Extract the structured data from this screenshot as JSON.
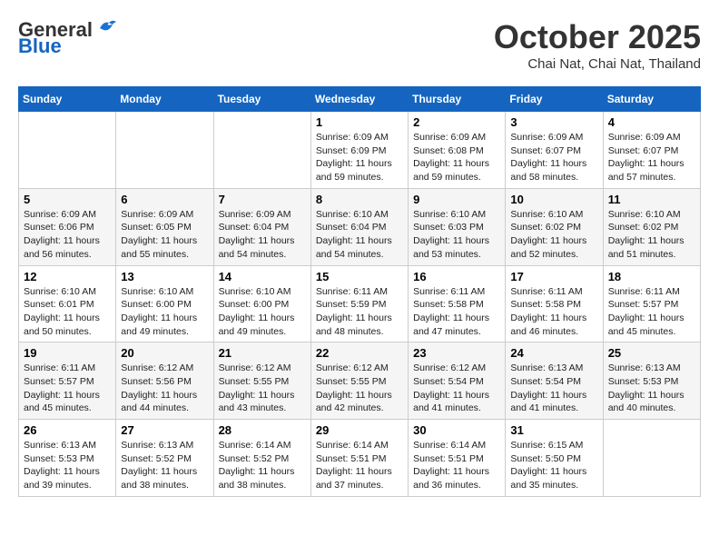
{
  "header": {
    "logo_general": "General",
    "logo_blue": "Blue",
    "month": "October 2025",
    "location": "Chai Nat, Chai Nat, Thailand"
  },
  "weekdays": [
    "Sunday",
    "Monday",
    "Tuesday",
    "Wednesday",
    "Thursday",
    "Friday",
    "Saturday"
  ],
  "weeks": [
    [
      {
        "day": "",
        "info": ""
      },
      {
        "day": "",
        "info": ""
      },
      {
        "day": "",
        "info": ""
      },
      {
        "day": "1",
        "info": "Sunrise: 6:09 AM\nSunset: 6:09 PM\nDaylight: 11 hours\nand 59 minutes."
      },
      {
        "day": "2",
        "info": "Sunrise: 6:09 AM\nSunset: 6:08 PM\nDaylight: 11 hours\nand 59 minutes."
      },
      {
        "day": "3",
        "info": "Sunrise: 6:09 AM\nSunset: 6:07 PM\nDaylight: 11 hours\nand 58 minutes."
      },
      {
        "day": "4",
        "info": "Sunrise: 6:09 AM\nSunset: 6:07 PM\nDaylight: 11 hours\nand 57 minutes."
      }
    ],
    [
      {
        "day": "5",
        "info": "Sunrise: 6:09 AM\nSunset: 6:06 PM\nDaylight: 11 hours\nand 56 minutes."
      },
      {
        "day": "6",
        "info": "Sunrise: 6:09 AM\nSunset: 6:05 PM\nDaylight: 11 hours\nand 55 minutes."
      },
      {
        "day": "7",
        "info": "Sunrise: 6:09 AM\nSunset: 6:04 PM\nDaylight: 11 hours\nand 54 minutes."
      },
      {
        "day": "8",
        "info": "Sunrise: 6:10 AM\nSunset: 6:04 PM\nDaylight: 11 hours\nand 54 minutes."
      },
      {
        "day": "9",
        "info": "Sunrise: 6:10 AM\nSunset: 6:03 PM\nDaylight: 11 hours\nand 53 minutes."
      },
      {
        "day": "10",
        "info": "Sunrise: 6:10 AM\nSunset: 6:02 PM\nDaylight: 11 hours\nand 52 minutes."
      },
      {
        "day": "11",
        "info": "Sunrise: 6:10 AM\nSunset: 6:02 PM\nDaylight: 11 hours\nand 51 minutes."
      }
    ],
    [
      {
        "day": "12",
        "info": "Sunrise: 6:10 AM\nSunset: 6:01 PM\nDaylight: 11 hours\nand 50 minutes."
      },
      {
        "day": "13",
        "info": "Sunrise: 6:10 AM\nSunset: 6:00 PM\nDaylight: 11 hours\nand 49 minutes."
      },
      {
        "day": "14",
        "info": "Sunrise: 6:10 AM\nSunset: 6:00 PM\nDaylight: 11 hours\nand 49 minutes."
      },
      {
        "day": "15",
        "info": "Sunrise: 6:11 AM\nSunset: 5:59 PM\nDaylight: 11 hours\nand 48 minutes."
      },
      {
        "day": "16",
        "info": "Sunrise: 6:11 AM\nSunset: 5:58 PM\nDaylight: 11 hours\nand 47 minutes."
      },
      {
        "day": "17",
        "info": "Sunrise: 6:11 AM\nSunset: 5:58 PM\nDaylight: 11 hours\nand 46 minutes."
      },
      {
        "day": "18",
        "info": "Sunrise: 6:11 AM\nSunset: 5:57 PM\nDaylight: 11 hours\nand 45 minutes."
      }
    ],
    [
      {
        "day": "19",
        "info": "Sunrise: 6:11 AM\nSunset: 5:57 PM\nDaylight: 11 hours\nand 45 minutes."
      },
      {
        "day": "20",
        "info": "Sunrise: 6:12 AM\nSunset: 5:56 PM\nDaylight: 11 hours\nand 44 minutes."
      },
      {
        "day": "21",
        "info": "Sunrise: 6:12 AM\nSunset: 5:55 PM\nDaylight: 11 hours\nand 43 minutes."
      },
      {
        "day": "22",
        "info": "Sunrise: 6:12 AM\nSunset: 5:55 PM\nDaylight: 11 hours\nand 42 minutes."
      },
      {
        "day": "23",
        "info": "Sunrise: 6:12 AM\nSunset: 5:54 PM\nDaylight: 11 hours\nand 41 minutes."
      },
      {
        "day": "24",
        "info": "Sunrise: 6:13 AM\nSunset: 5:54 PM\nDaylight: 11 hours\nand 41 minutes."
      },
      {
        "day": "25",
        "info": "Sunrise: 6:13 AM\nSunset: 5:53 PM\nDaylight: 11 hours\nand 40 minutes."
      }
    ],
    [
      {
        "day": "26",
        "info": "Sunrise: 6:13 AM\nSunset: 5:53 PM\nDaylight: 11 hours\nand 39 minutes."
      },
      {
        "day": "27",
        "info": "Sunrise: 6:13 AM\nSunset: 5:52 PM\nDaylight: 11 hours\nand 38 minutes."
      },
      {
        "day": "28",
        "info": "Sunrise: 6:14 AM\nSunset: 5:52 PM\nDaylight: 11 hours\nand 38 minutes."
      },
      {
        "day": "29",
        "info": "Sunrise: 6:14 AM\nSunset: 5:51 PM\nDaylight: 11 hours\nand 37 minutes."
      },
      {
        "day": "30",
        "info": "Sunrise: 6:14 AM\nSunset: 5:51 PM\nDaylight: 11 hours\nand 36 minutes."
      },
      {
        "day": "31",
        "info": "Sunrise: 6:15 AM\nSunset: 5:50 PM\nDaylight: 11 hours\nand 35 minutes."
      },
      {
        "day": "",
        "info": ""
      }
    ]
  ]
}
